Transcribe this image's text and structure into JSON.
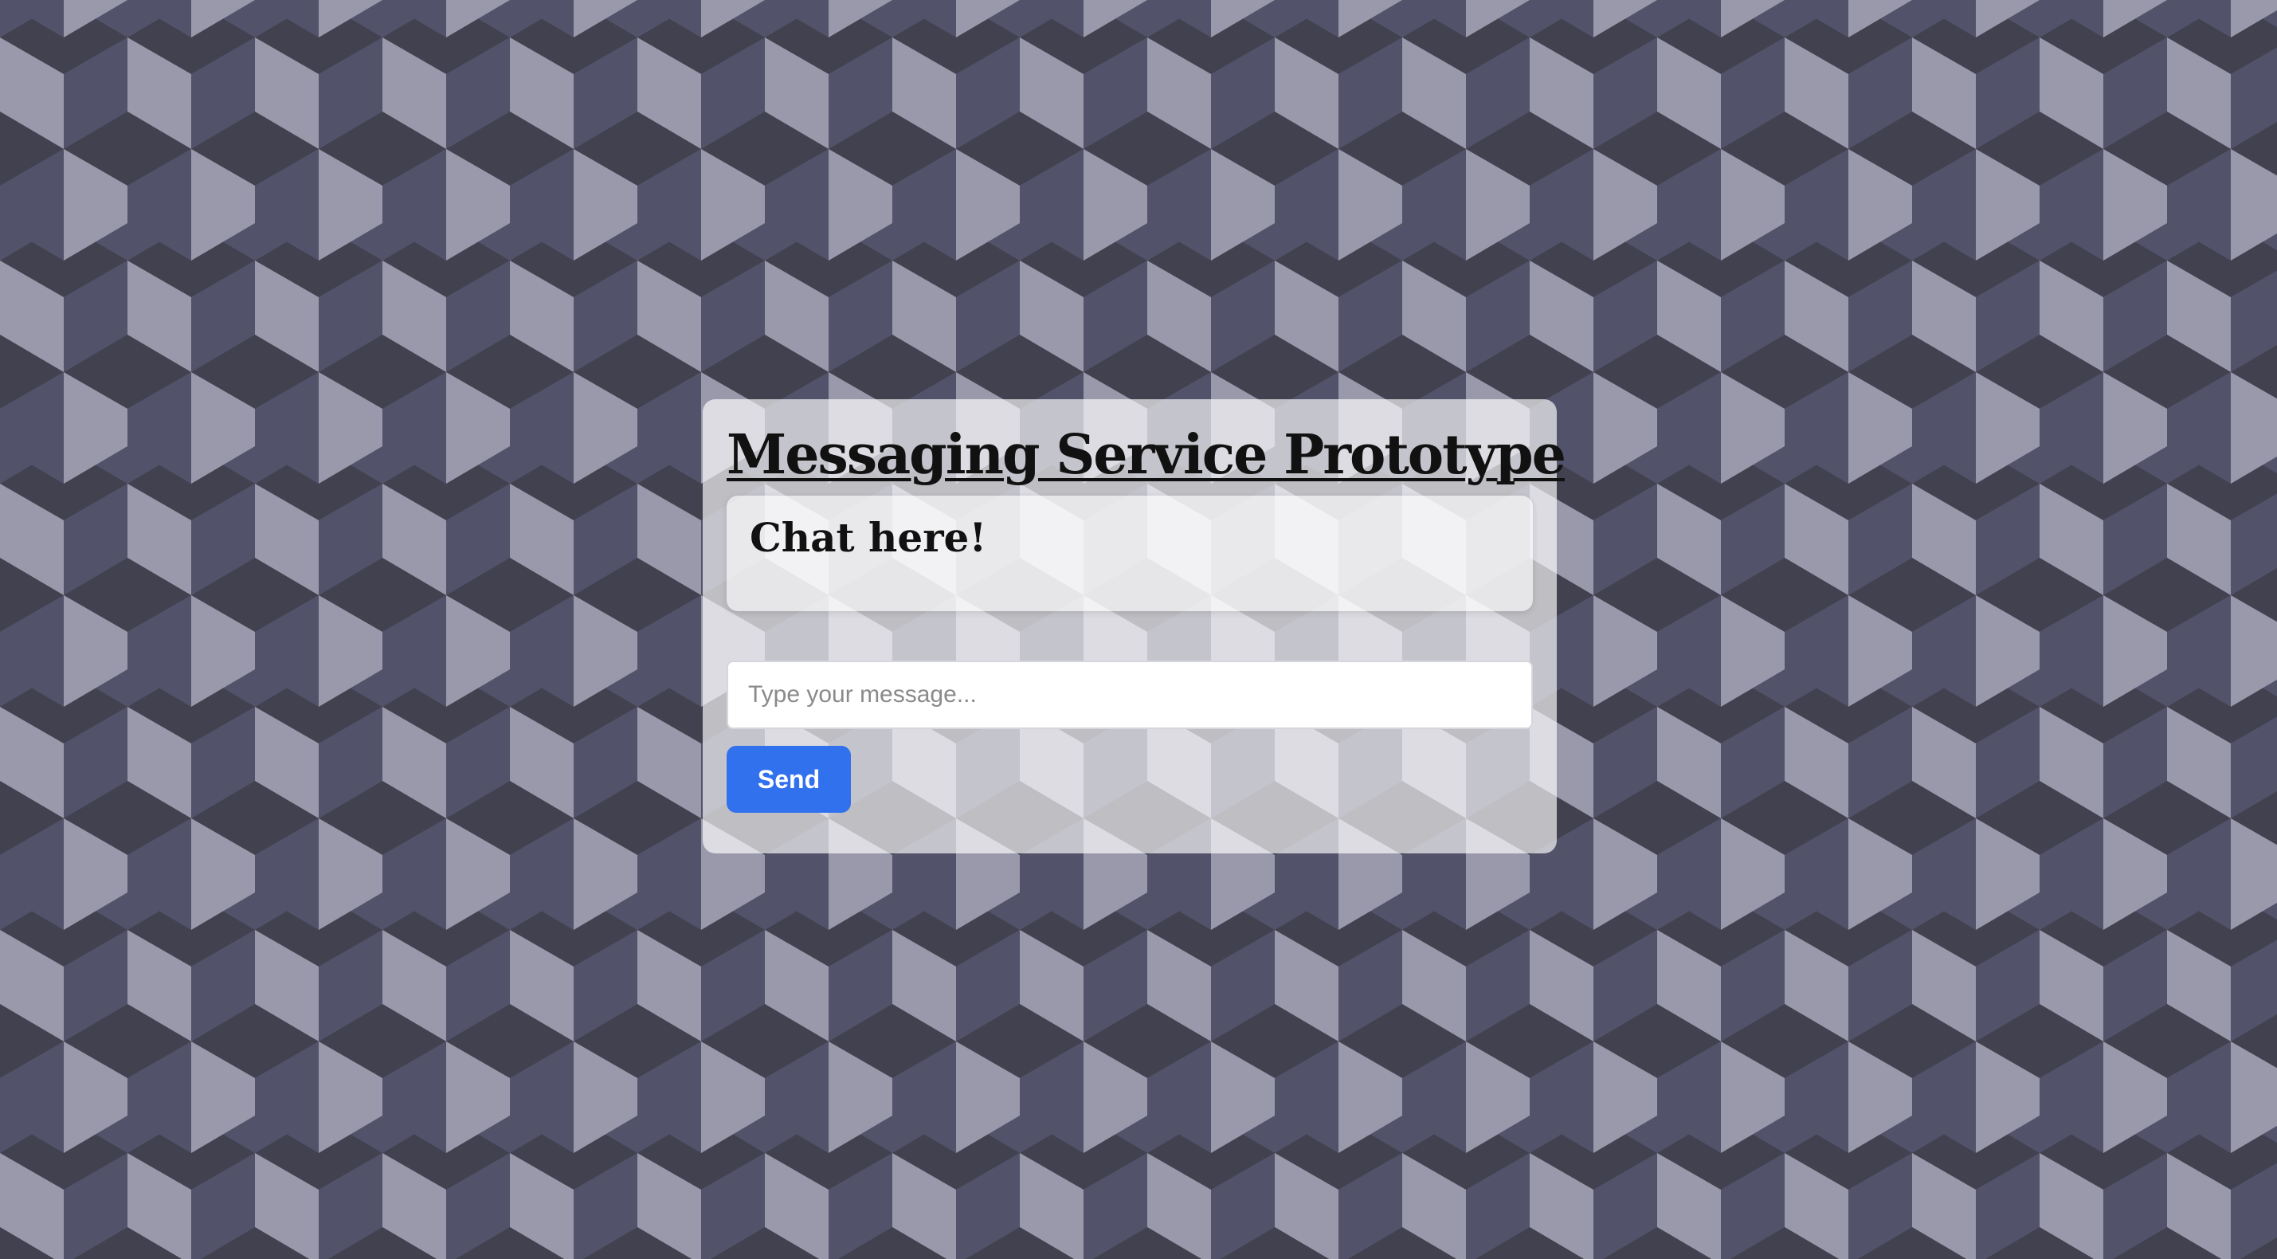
{
  "page": {
    "title": "Messaging Service Prototype"
  },
  "chat": {
    "heading": "Chat here!"
  },
  "composer": {
    "input_value": "",
    "input_placeholder": "Type your message...",
    "send_label": "Send"
  },
  "theme": {
    "background_dark": "#42414f",
    "background_mid": "#52526a",
    "background_light": "#9a99ab",
    "accent": "#3171ed",
    "button_text": "#ffffff"
  }
}
